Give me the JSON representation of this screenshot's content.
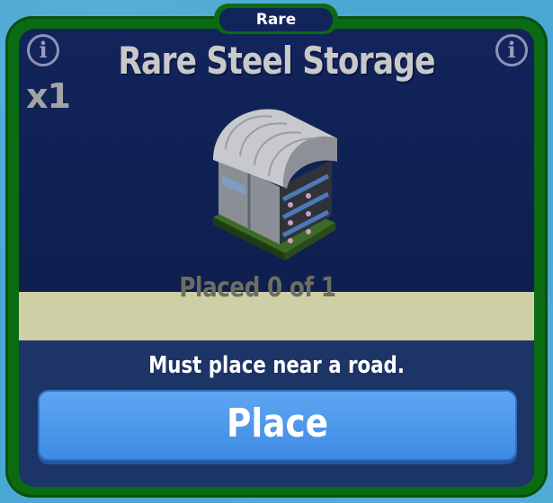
{
  "card": {
    "rarity": "Rare",
    "title": "Rare Steel Storage",
    "quantity": "x1",
    "info_icon": "info-icon",
    "building_icon": "steel-storage-building",
    "placed_status": "Placed 0 of 1",
    "placement_hint": "Must place near a road.",
    "place_button_label": "Place"
  },
  "colors": {
    "frame": "#0b6b12",
    "panel": "#12255a",
    "status_bar": "#cfcfa6",
    "button": "#4a96ec",
    "background": "#4aa8d4"
  }
}
